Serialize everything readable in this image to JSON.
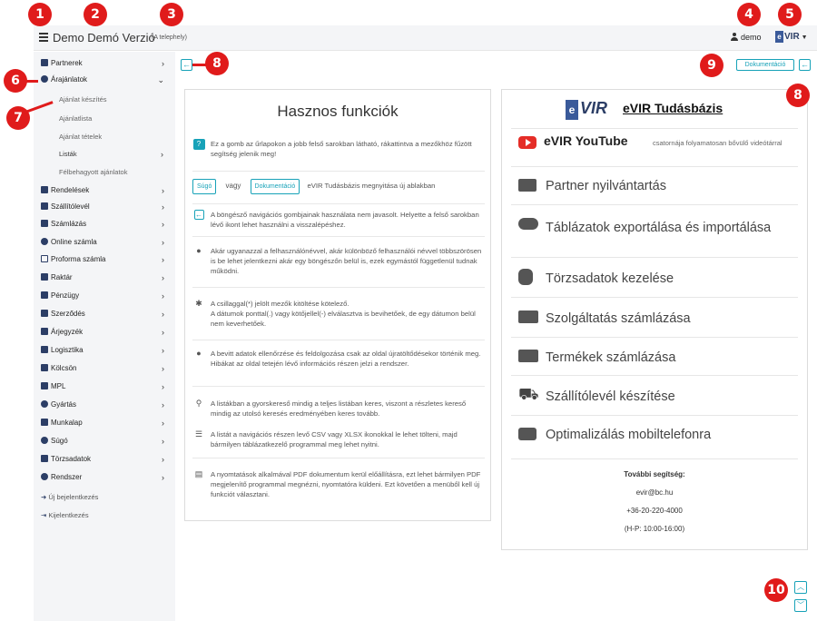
{
  "topbar": {
    "app_title": "Demo Demó Verzió",
    "site_label": "(A telephely)",
    "user_name": "demo",
    "logo_text": "VIR"
  },
  "sidebar": {
    "items": [
      {
        "label": "Partnerek",
        "icon": "partner-icon",
        "chevron": ">"
      },
      {
        "label": "Árajánlatok",
        "icon": "offers-icon",
        "chevron": "v"
      },
      {
        "label": "Rendelések",
        "icon": "orders-icon",
        "chevron": ">"
      },
      {
        "label": "Szállítólevél",
        "icon": "delivery-note-icon",
        "chevron": ">"
      },
      {
        "label": "Számlázás",
        "icon": "invoice-icon",
        "chevron": ">"
      },
      {
        "label": "Online számla",
        "icon": "globe-icon",
        "chevron": ">"
      },
      {
        "label": "Proforma számla",
        "icon": "proforma-icon",
        "chevron": ">"
      },
      {
        "label": "Raktár",
        "icon": "warehouse-icon",
        "chevron": ">"
      },
      {
        "label": "Pénzügy",
        "icon": "money-icon",
        "chevron": ">"
      },
      {
        "label": "Szerződés",
        "icon": "contract-icon",
        "chevron": ">"
      },
      {
        "label": "Árjegyzék",
        "icon": "tag-icon",
        "chevron": ">"
      },
      {
        "label": "Logisztika",
        "icon": "dolly-icon",
        "chevron": ">"
      },
      {
        "label": "Kölcsön",
        "icon": "loan-icon",
        "chevron": ">"
      },
      {
        "label": "MPL",
        "icon": "mpl-icon",
        "chevron": ">"
      },
      {
        "label": "Gyártás",
        "icon": "cogs-icon",
        "chevron": ">"
      },
      {
        "label": "Munkalap",
        "icon": "worksheet-icon",
        "chevron": ">"
      },
      {
        "label": "Súgó",
        "icon": "question-icon",
        "chevron": ">"
      },
      {
        "label": "Törzsadatok",
        "icon": "database-icon",
        "chevron": ">"
      },
      {
        "label": "Rendszer",
        "icon": "system-icon",
        "chevron": ">"
      }
    ],
    "sub_items": [
      {
        "label": "Ajánlat készítés"
      },
      {
        "label": "Ajánlatlista"
      },
      {
        "label": "Ajánlat tételek"
      },
      {
        "label": "Listák",
        "chevron": ">"
      },
      {
        "label": "Félbehagyott ajánlatok"
      }
    ],
    "bottom": [
      {
        "label": "Új bejelentkezés"
      },
      {
        "label": "Kijelentkezés"
      }
    ]
  },
  "toolbar": {
    "back_arrow": "←",
    "doc_label": "Dokumentáció"
  },
  "tips": {
    "title": "Hasznos funkciók",
    "help_icon_glyph": "?",
    "tip1": "Ez a gomb az űrlapokon a jobb felső sarokban látható, rákattintva a mezőkhöz fűzött segítség jelenik meg!",
    "tip2_sugo": "Súgó",
    "tip2_vagy": "vagy",
    "tip2_doc": "Dokumentáció",
    "tip2_text": "eVIR Tudásbázis megnyitása új ablakban",
    "tip3": "A böngésző navigációs gombjainak használata nem javasolt. Helyette a felső sarokban lévő ikont lehet használni a visszalépéshez.",
    "tip4": "Akár ugyanazzal a felhasználónévvel, akár különböző felhasználói névvel többszörösen is be lehet jelentkezni akár egy böngészőn belül is, ezek egymástól függetlenül tudnak működni.",
    "tip5a": "A csillaggal(*) jelölt mezők kitöltése kötelező.",
    "tip5b": "A dátumok ponttal(.) vagy kötőjellel(-) elválasztva is bevihetőek, de egy dátumon belül nem keverhetőek.",
    "tip6": "A bevitt adatok ellenőrzése és feldolgozása csak az oldal újratöltődésekor történik meg. Hibákat az oldal tetején lévő információs részen jelzi a rendszer.",
    "tip7": "A listákban a gyorskereső mindig a teljes listában keres, viszont a részletes kereső mindig az utolsó keresés eredményében keres tovább.",
    "tip8": "A listát a navigációs részen levő CSV vagy XLSX ikonokkal le lehet tölteni, majd bármilyen táblázatkezelő programmal meg lehet nyitni.",
    "tip9": "A nyomtatások alkalmával PDF dokumentum kerül előállításra, ezt lehet bármilyen PDF megjelenítő programmal megnézni, nyomtatóra küldeni. Ezt követően a menüből kell új funkciót választani."
  },
  "knowledge_base": {
    "logo_text": "VIR",
    "title": "eVIR Tudásbázis",
    "youtube_label": "eVIR YouTube",
    "youtube_note": "csatornája folyamatosan bővülő videótárral",
    "rows": [
      "Partner nyilvántartás",
      "Táblázatok exportálása és importálása",
      "Törzsadatok kezelése",
      "Szolgáltatás számlázása",
      "Termékek számlázása",
      "Szállítólevél készítése",
      "Optimalizálás mobiltelefonra"
    ],
    "more_help_title": "További segítség:",
    "email": "evir@bc.hu",
    "phone": "+36-20-220-4000",
    "hours": "(H-P: 10:00-16:00)"
  },
  "markers": [
    "1",
    "2",
    "3",
    "4",
    "5",
    "6",
    "7",
    "8",
    "8",
    "9",
    "10"
  ],
  "colors": {
    "accent": "#17a2b8",
    "marker": "#e01b1b",
    "brand": "#2c3e66",
    "youtube": "#e52d27"
  }
}
